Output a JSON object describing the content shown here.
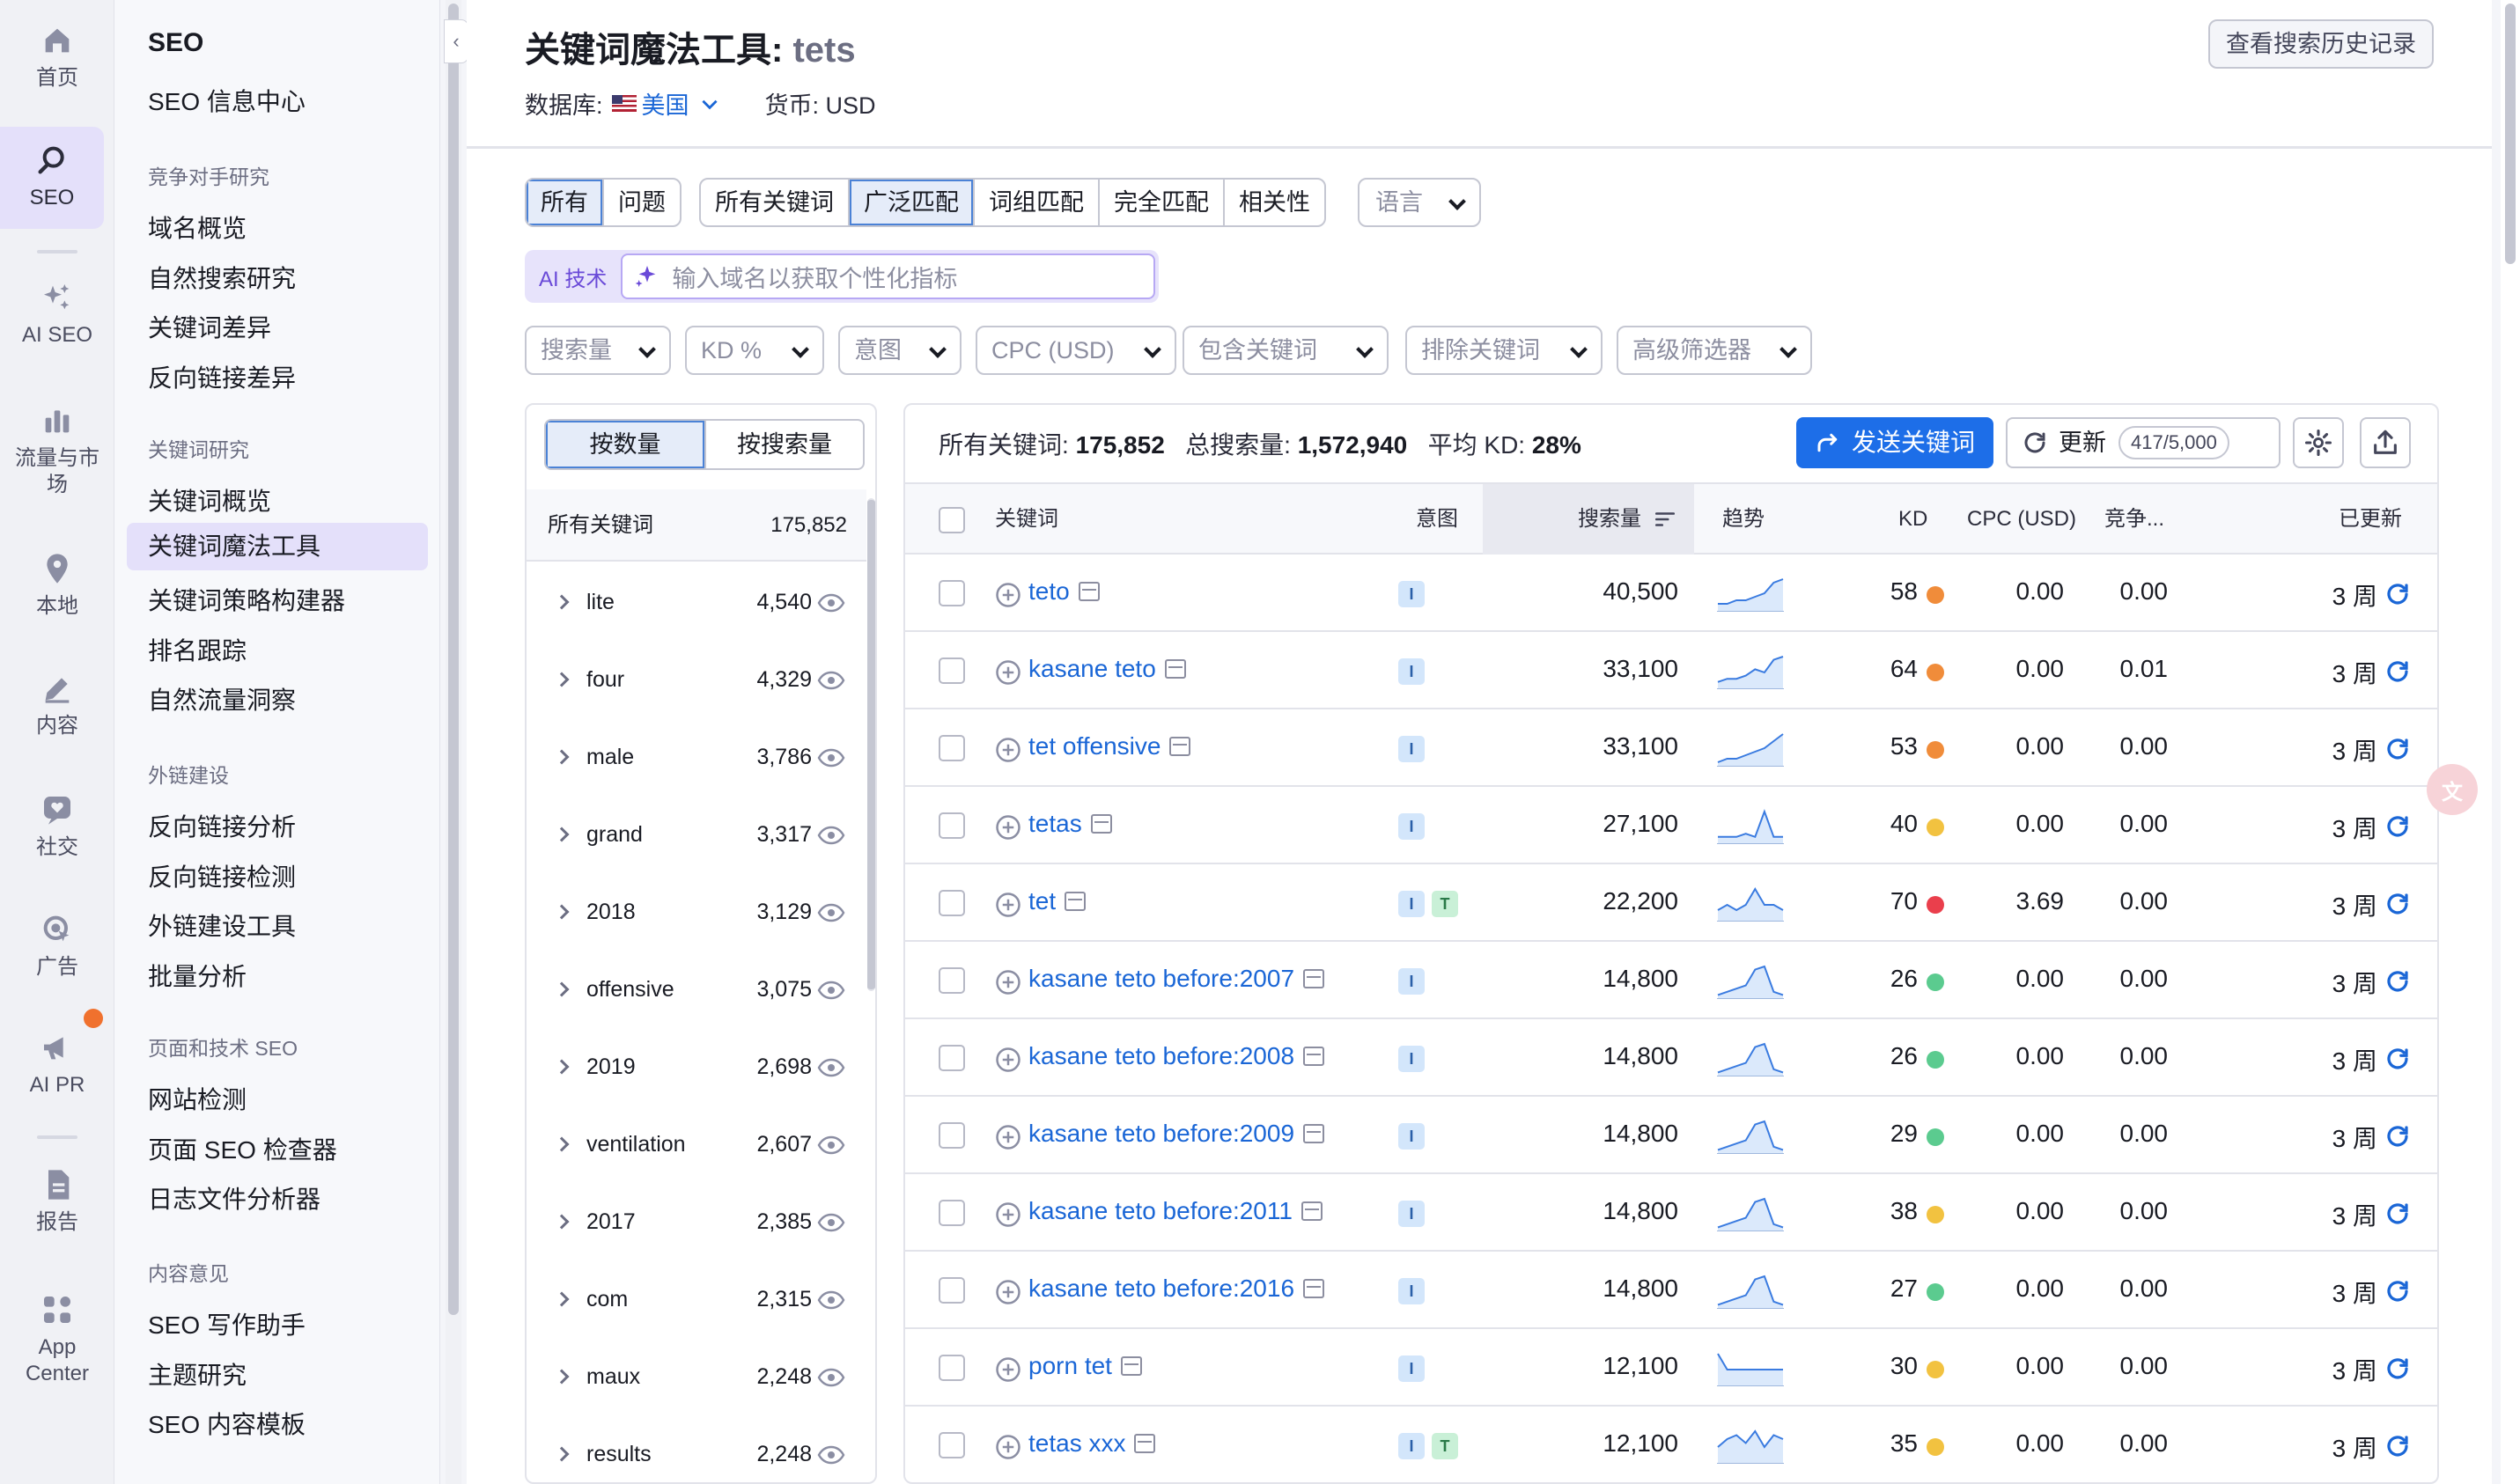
{
  "rail": [
    {
      "label": "首页",
      "icon": "home-icon"
    },
    {
      "label": "SEO",
      "icon": "seo-icon"
    },
    {
      "label": "AI SEO",
      "icon": "sparkles-icon"
    },
    {
      "label": "流量与市场",
      "icon": "bar-chart-icon"
    },
    {
      "label": "本地",
      "icon": "location-pin-icon"
    },
    {
      "label": "内容",
      "icon": "pencil-icon"
    },
    {
      "label": "社交",
      "icon": "heart-chat-icon"
    },
    {
      "label": "广告",
      "icon": "target-cursor-icon"
    },
    {
      "label": "AI PR",
      "icon": "megaphone-icon"
    },
    {
      "label": "报告",
      "icon": "report-icon"
    },
    {
      "label": "App Center",
      "icon": "apps-grid-icon"
    }
  ],
  "menu": {
    "title": "SEO",
    "home": "SEO 信息中心",
    "sections": [
      {
        "label": "竞争对手研究",
        "items": [
          "域名概览",
          "自然搜索研究",
          "关键词差异",
          "反向链接差异"
        ]
      },
      {
        "label": "关键词研究",
        "items": [
          "关键词概览",
          "关键词魔法工具",
          "关键词策略构建器",
          "排名跟踪",
          "自然流量洞察"
        ]
      },
      {
        "label": "外链建设",
        "items": [
          "反向链接分析",
          "反向链接检测",
          "外链建设工具",
          "批量分析"
        ]
      },
      {
        "label": "页面和技术 SEO",
        "items": [
          "网站检测",
          "页面 SEO 检查器",
          "日志文件分析器"
        ]
      },
      {
        "label": "内容意见",
        "items": [
          "SEO 写作助手",
          "主题研究",
          "SEO 内容模板"
        ]
      }
    ],
    "active": "关键词魔法工具"
  },
  "header": {
    "title_prefix": "关键词魔法工具:",
    "query": "tets",
    "history_button": "查看搜索历史记录",
    "db_label": "数据库:",
    "db_value": "美国",
    "currency": "货币: USD"
  },
  "tabs_type": [
    "所有",
    "问题"
  ],
  "tabs_match": [
    "所有关键词",
    "广泛匹配",
    "词组匹配",
    "完全匹配",
    "相关性"
  ],
  "language_placeholder": "语言",
  "ai": {
    "tag": "AI 技术",
    "placeholder": "输入域名以获取个性化指标"
  },
  "filters": [
    "搜索量",
    "KD %",
    "意图",
    "CPC (USD)",
    "包含关键词",
    "排除关键词",
    "高级筛选器"
  ],
  "groups": {
    "toggle": [
      "按数量",
      "按搜索量"
    ],
    "header_label": "所有关键词",
    "header_count": "175,852",
    "items": [
      {
        "name": "lite",
        "count": "4,540"
      },
      {
        "name": "four",
        "count": "4,329"
      },
      {
        "name": "male",
        "count": "3,786"
      },
      {
        "name": "grand",
        "count": "3,317"
      },
      {
        "name": "2018",
        "count": "3,129"
      },
      {
        "name": "offensive",
        "count": "3,075"
      },
      {
        "name": "2019",
        "count": "2,698"
      },
      {
        "name": "ventilation",
        "count": "2,607"
      },
      {
        "name": "2017",
        "count": "2,385"
      },
      {
        "name": "com",
        "count": "2,315"
      },
      {
        "name": "maux",
        "count": "2,248"
      },
      {
        "name": "results",
        "count": "2,248"
      }
    ]
  },
  "summary": {
    "all_label": "所有关键词:",
    "all_value": "175,852",
    "vol_label": "总搜索量:",
    "vol_value": "1,572,940",
    "kd_label": "平均 KD:",
    "kd_value": "28%"
  },
  "actions": {
    "send": "发送关键词",
    "update": "更新",
    "update_count": "417/5,000"
  },
  "columns": {
    "keyword": "关键词",
    "intent": "意图",
    "volume": "搜索量",
    "trend": "趋势",
    "kd": "KD",
    "cpc": "CPC (USD)",
    "comp": "竞争...",
    "updated": "已更新"
  },
  "colors": {
    "kd_orange": "#f08c3a",
    "kd_yellow": "#f2c240",
    "kd_red": "#ea3f4c",
    "kd_green": "#5bcb8f",
    "accent": "#1d6ee8"
  },
  "rows": [
    {
      "kw": "teto",
      "intent": [
        "I"
      ],
      "vol": "40,500",
      "kd": "58",
      "kdc": "orange",
      "cpc": "0.00",
      "comp": "0.00",
      "upd": "3 周",
      "trend": [
        2,
        2,
        3,
        3,
        4,
        5,
        8,
        9
      ]
    },
    {
      "kw": "kasane teto",
      "intent": [
        "I"
      ],
      "vol": "33,100",
      "kd": "64",
      "kdc": "orange",
      "cpc": "0.00",
      "comp": "0.01",
      "upd": "3 周",
      "trend": [
        2,
        3,
        3,
        4,
        6,
        5,
        9,
        10
      ]
    },
    {
      "kw": "tet offensive",
      "intent": [
        "I"
      ],
      "vol": "33,100",
      "kd": "53",
      "kdc": "orange",
      "cpc": "0.00",
      "comp": "0.00",
      "upd": "3 周",
      "trend": [
        1,
        2,
        2,
        3,
        4,
        5,
        7,
        9
      ]
    },
    {
      "kw": "tetas",
      "intent": [
        "I"
      ],
      "vol": "27,100",
      "kd": "40",
      "kdc": "yellow",
      "cpc": "0.00",
      "comp": "0.00",
      "upd": "3 周",
      "trend": [
        2,
        2,
        2,
        3,
        2,
        10,
        2,
        2
      ]
    },
    {
      "kw": "tet",
      "intent": [
        "I",
        "T"
      ],
      "vol": "22,200",
      "kd": "70",
      "kdc": "red",
      "cpc": "3.69",
      "comp": "0.00",
      "upd": "3 周",
      "trend": [
        2,
        3,
        2,
        3,
        6,
        3,
        3,
        2
      ]
    },
    {
      "kw": "kasane teto before:2007",
      "intent": [
        "I"
      ],
      "vol": "14,800",
      "kd": "26",
      "kdc": "green",
      "cpc": "0.00",
      "comp": "0.00",
      "upd": "3 周",
      "trend": [
        1,
        2,
        3,
        4,
        9,
        10,
        2,
        1
      ]
    },
    {
      "kw": "kasane teto before:2008",
      "intent": [
        "I"
      ],
      "vol": "14,800",
      "kd": "26",
      "kdc": "green",
      "cpc": "0.00",
      "comp": "0.00",
      "upd": "3 周",
      "trend": [
        1,
        2,
        3,
        4,
        9,
        10,
        2,
        1
      ]
    },
    {
      "kw": "kasane teto before:2009",
      "intent": [
        "I"
      ],
      "vol": "14,800",
      "kd": "29",
      "kdc": "green",
      "cpc": "0.00",
      "comp": "0.00",
      "upd": "3 周",
      "trend": [
        1,
        2,
        3,
        4,
        9,
        10,
        2,
        1
      ]
    },
    {
      "kw": "kasane teto before:2011",
      "intent": [
        "I"
      ],
      "vol": "14,800",
      "kd": "38",
      "kdc": "yellow",
      "cpc": "0.00",
      "comp": "0.00",
      "upd": "3 周",
      "trend": [
        1,
        2,
        3,
        4,
        9,
        10,
        2,
        1
      ]
    },
    {
      "kw": "kasane teto before:2016",
      "intent": [
        "I"
      ],
      "vol": "14,800",
      "kd": "27",
      "kdc": "green",
      "cpc": "0.00",
      "comp": "0.00",
      "upd": "3 周",
      "trend": [
        1,
        2,
        3,
        4,
        9,
        10,
        2,
        1
      ]
    },
    {
      "kw": "porn tet",
      "intent": [
        "I"
      ],
      "vol": "12,100",
      "kd": "30",
      "kdc": "yellow",
      "cpc": "0.00",
      "comp": "0.00",
      "upd": "3 周",
      "trend": [
        10,
        5,
        5,
        5,
        5,
        5,
        5,
        5
      ]
    },
    {
      "kw": "tetas xxx",
      "intent": [
        "I",
        "T"
      ],
      "vol": "12,100",
      "kd": "35",
      "kdc": "yellow",
      "cpc": "0.00",
      "comp": "0.00",
      "upd": "3 周",
      "trend": [
        4,
        6,
        7,
        5,
        8,
        4,
        7,
        6
      ]
    }
  ]
}
